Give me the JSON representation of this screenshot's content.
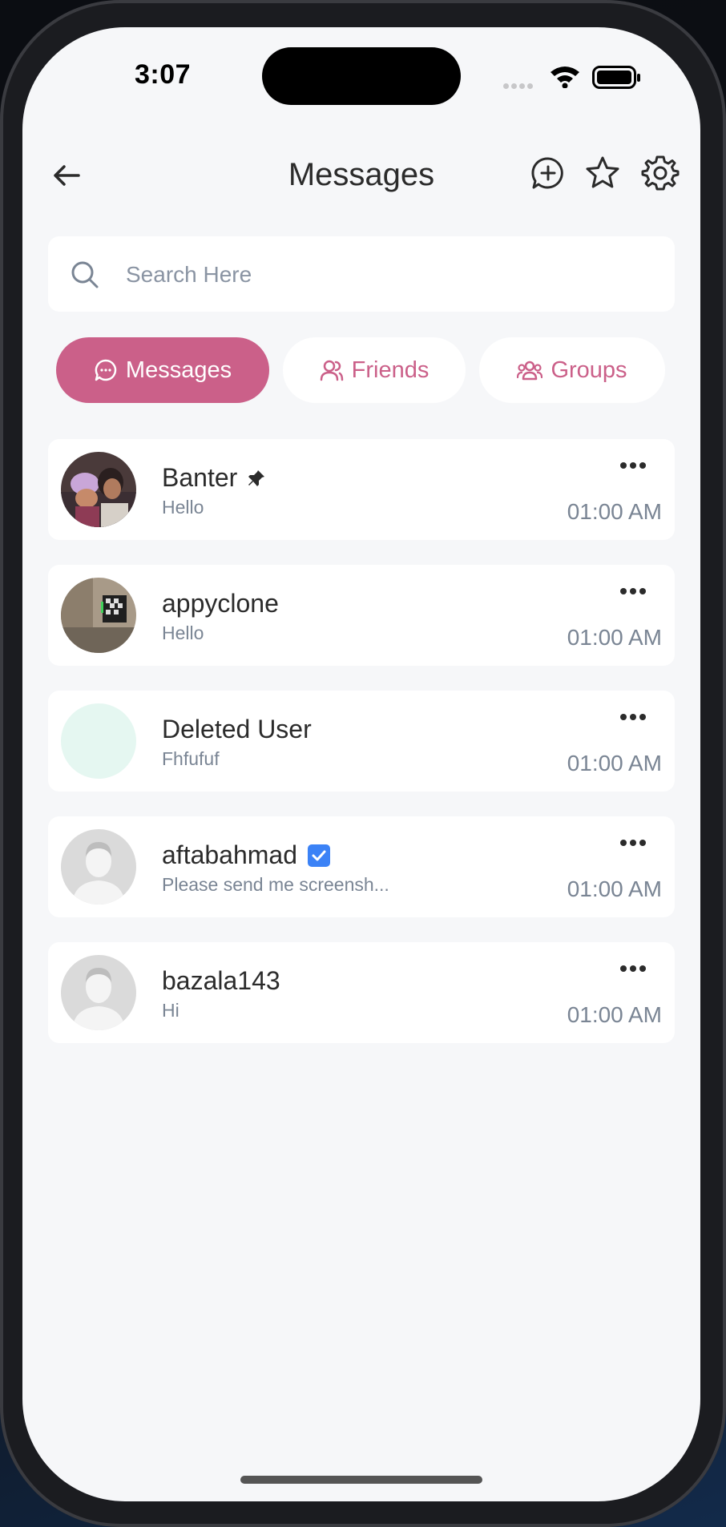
{
  "status_bar": {
    "time": "3:07"
  },
  "header": {
    "title": "Messages"
  },
  "search": {
    "placeholder": "Search Here",
    "value": ""
  },
  "tabs": [
    {
      "label": "Messages",
      "active": true,
      "icon": "chat-bubble-icon"
    },
    {
      "label": "Friends",
      "active": false,
      "icon": "users-icon"
    },
    {
      "label": "Groups",
      "active": false,
      "icon": "group-icon"
    }
  ],
  "conversations": [
    {
      "name": "Banter",
      "preview": "Hello",
      "time": "01:00 AM",
      "badge": "pin-icon",
      "avatar": "photo"
    },
    {
      "name": "appyclone",
      "preview": "Hello",
      "time": "01:00 AM",
      "badge": "",
      "avatar": "photo"
    },
    {
      "name": "Deleted User",
      "preview": "Fhfufuf",
      "time": "01:00 AM",
      "badge": "",
      "avatar": "blank"
    },
    {
      "name": "aftabahmad",
      "preview": "Please send me screensh...",
      "time": "01:00 AM",
      "badge": "verified-icon",
      "avatar": "default"
    },
    {
      "name": "bazala143",
      "preview": "Hi",
      "time": "01:00 AM",
      "badge": "",
      "avatar": "default"
    }
  ],
  "colors": {
    "accent": "#cb6089",
    "background": "#f6f7f9",
    "muted_text": "#7a8594",
    "verified": "#3b82f6"
  }
}
